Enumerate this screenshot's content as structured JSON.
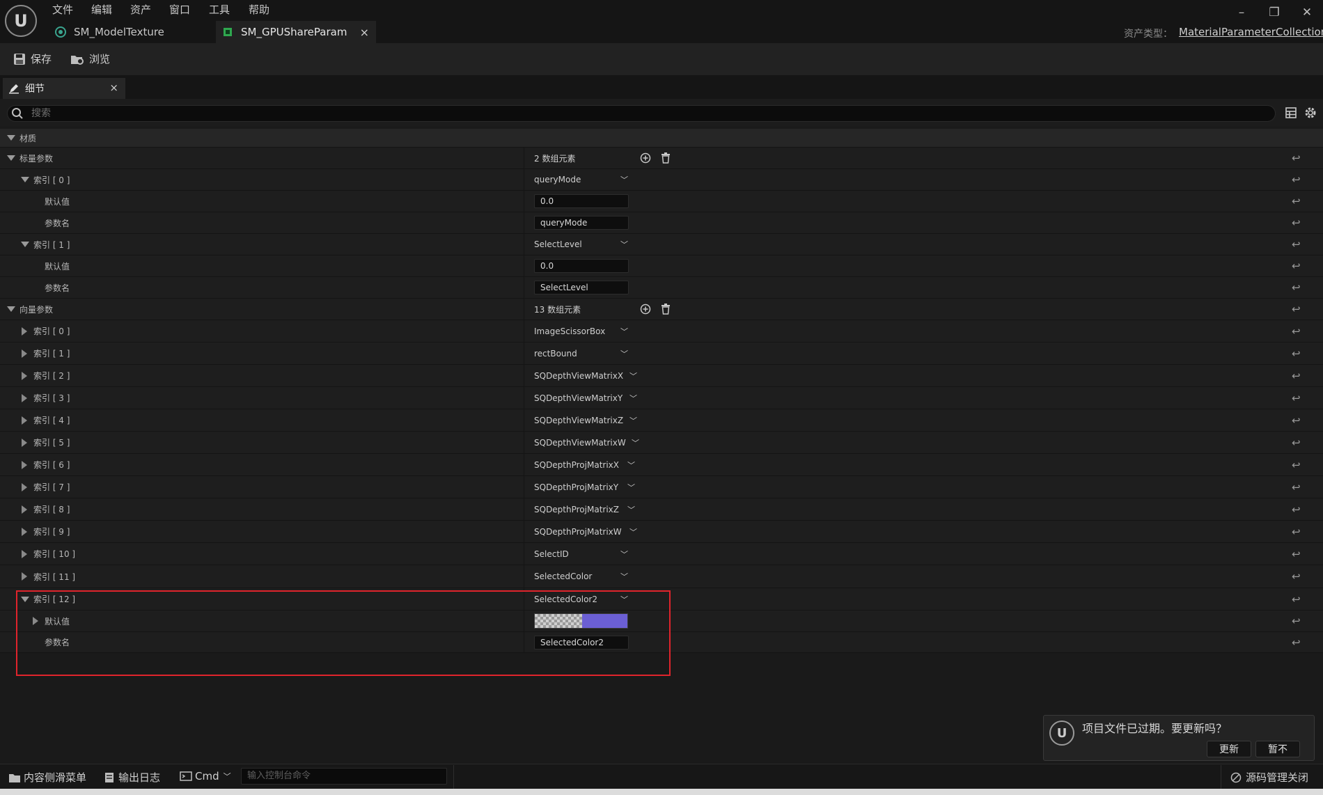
{
  "menu": [
    "文件",
    "编辑",
    "资产",
    "窗口",
    "工具",
    "帮助"
  ],
  "tabs": [
    {
      "label": "SM_ModelTexture"
    },
    {
      "label": "SM_GPUShareParam",
      "close": "×"
    }
  ],
  "asset_type": {
    "label": "资产类型：",
    "value": "MaterialParameterCollection"
  },
  "window_controls": {
    "minimize": "–",
    "restore": "❐",
    "close": "✕"
  },
  "toolbar": {
    "save": "保存",
    "browse": "浏览"
  },
  "details_panel": {
    "title": "细节",
    "close": "×"
  },
  "search": {
    "placeholder": "搜索"
  },
  "category": "材质",
  "scalar": {
    "label": "标量参数",
    "count": "2 数组元素",
    "items": [
      {
        "index": "索引 [ 0 ]",
        "value": "queryMode",
        "default_label": "默认值",
        "default": "0.0",
        "param_label": "参数名",
        "param": "queryMode"
      },
      {
        "index": "索引 [ 1 ]",
        "value": "SelectLevel",
        "default_label": "默认值",
        "default": "0.0",
        "param_label": "参数名",
        "param": "SelectLevel"
      }
    ]
  },
  "vector": {
    "label": "向量参数",
    "count": "13 数组元素",
    "items": [
      {
        "index": "索引 [ 0 ]",
        "value": "ImageScissorBox"
      },
      {
        "index": "索引 [ 1 ]",
        "value": "rectBound"
      },
      {
        "index": "索引 [ 2 ]",
        "value": "SQDepthViewMatrixX"
      },
      {
        "index": "索引 [ 3 ]",
        "value": "SQDepthViewMatrixY"
      },
      {
        "index": "索引 [ 4 ]",
        "value": "SQDepthViewMatrixZ"
      },
      {
        "index": "索引 [ 5 ]",
        "value": "SQDepthViewMatrixW"
      },
      {
        "index": "索引 [ 6 ]",
        "value": "SQDepthProjMatrixX"
      },
      {
        "index": "索引 [ 7 ]",
        "value": "SQDepthProjMatrixY"
      },
      {
        "index": "索引 [ 8 ]",
        "value": "SQDepthProjMatrixZ"
      },
      {
        "index": "索引 [ 9 ]",
        "value": "SQDepthProjMatrixW"
      },
      {
        "index": "索引 [ 10 ]",
        "value": "SelectID"
      },
      {
        "index": "索引 [ 11 ]",
        "value": "SelectedColor"
      }
    ],
    "expanded": {
      "index": "索引 [ 12 ]",
      "value": "SelectedColor2",
      "default_label": "默认值",
      "color": "#6b5fd4",
      "param_label": "参数名",
      "param": "SelectedColor2"
    }
  },
  "toast": {
    "message": "项目文件已过期。要更新吗？",
    "update": "更新",
    "later": "暂不"
  },
  "statusbar": {
    "content_drawer": "内容侧滑菜单",
    "output_log": "输出日志",
    "cmd": "Cmd",
    "console_placeholder": "输入控制台命令",
    "source_control": "源码管理关闭"
  },
  "colors": {
    "highlight": "#e0242c",
    "tab_icon_teal": "#3aa58f",
    "tab_icon_green": "#2fa84f"
  }
}
